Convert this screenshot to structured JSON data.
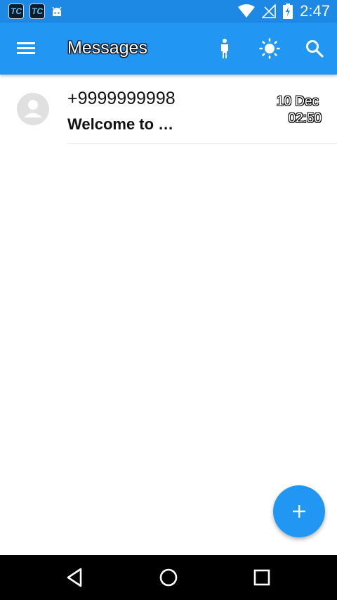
{
  "status_bar": {
    "notif_icons": [
      "TC",
      "TC"
    ],
    "time": "2:47"
  },
  "app_bar": {
    "title": "Messages",
    "icons": [
      "menu-icon",
      "person-icon",
      "brightness-icon",
      "search-icon"
    ]
  },
  "conversations": [
    {
      "name": "+9999999998",
      "snippet": "Welcome to  …",
      "date": "10 Dec",
      "time": "02:50"
    }
  ],
  "fab": {
    "icon": "plus-icon"
  },
  "colors": {
    "primary": "#2196f3",
    "status_bar": "#1e88e5",
    "nav_bar": "#000000",
    "avatar": "#e0e0e0"
  }
}
